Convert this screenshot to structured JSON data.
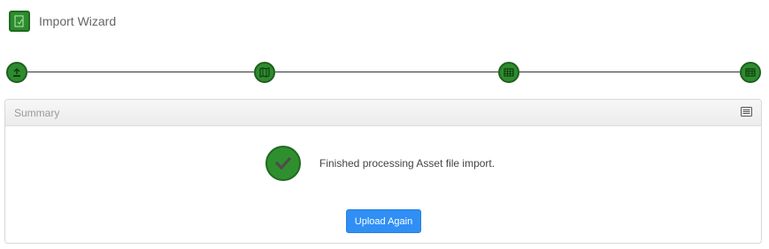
{
  "app": {
    "title": "Import Wizard",
    "icon": "file-import-icon"
  },
  "stepper": {
    "steps": [
      {
        "icon": "upload-icon",
        "state": "complete"
      },
      {
        "icon": "map-icon",
        "state": "complete"
      },
      {
        "icon": "grid-icon",
        "state": "complete"
      },
      {
        "icon": "table-icon",
        "state": "complete"
      }
    ],
    "color": "#2e8b2e"
  },
  "panel": {
    "title": "Summary",
    "header_icon": "list-icon",
    "status_icon": "check-icon",
    "status_message": "Finished processing Asset file import.",
    "action_label": "Upload Again"
  },
  "colors": {
    "success": "#2e8b2e",
    "primary_button": "#2f8ff5"
  }
}
